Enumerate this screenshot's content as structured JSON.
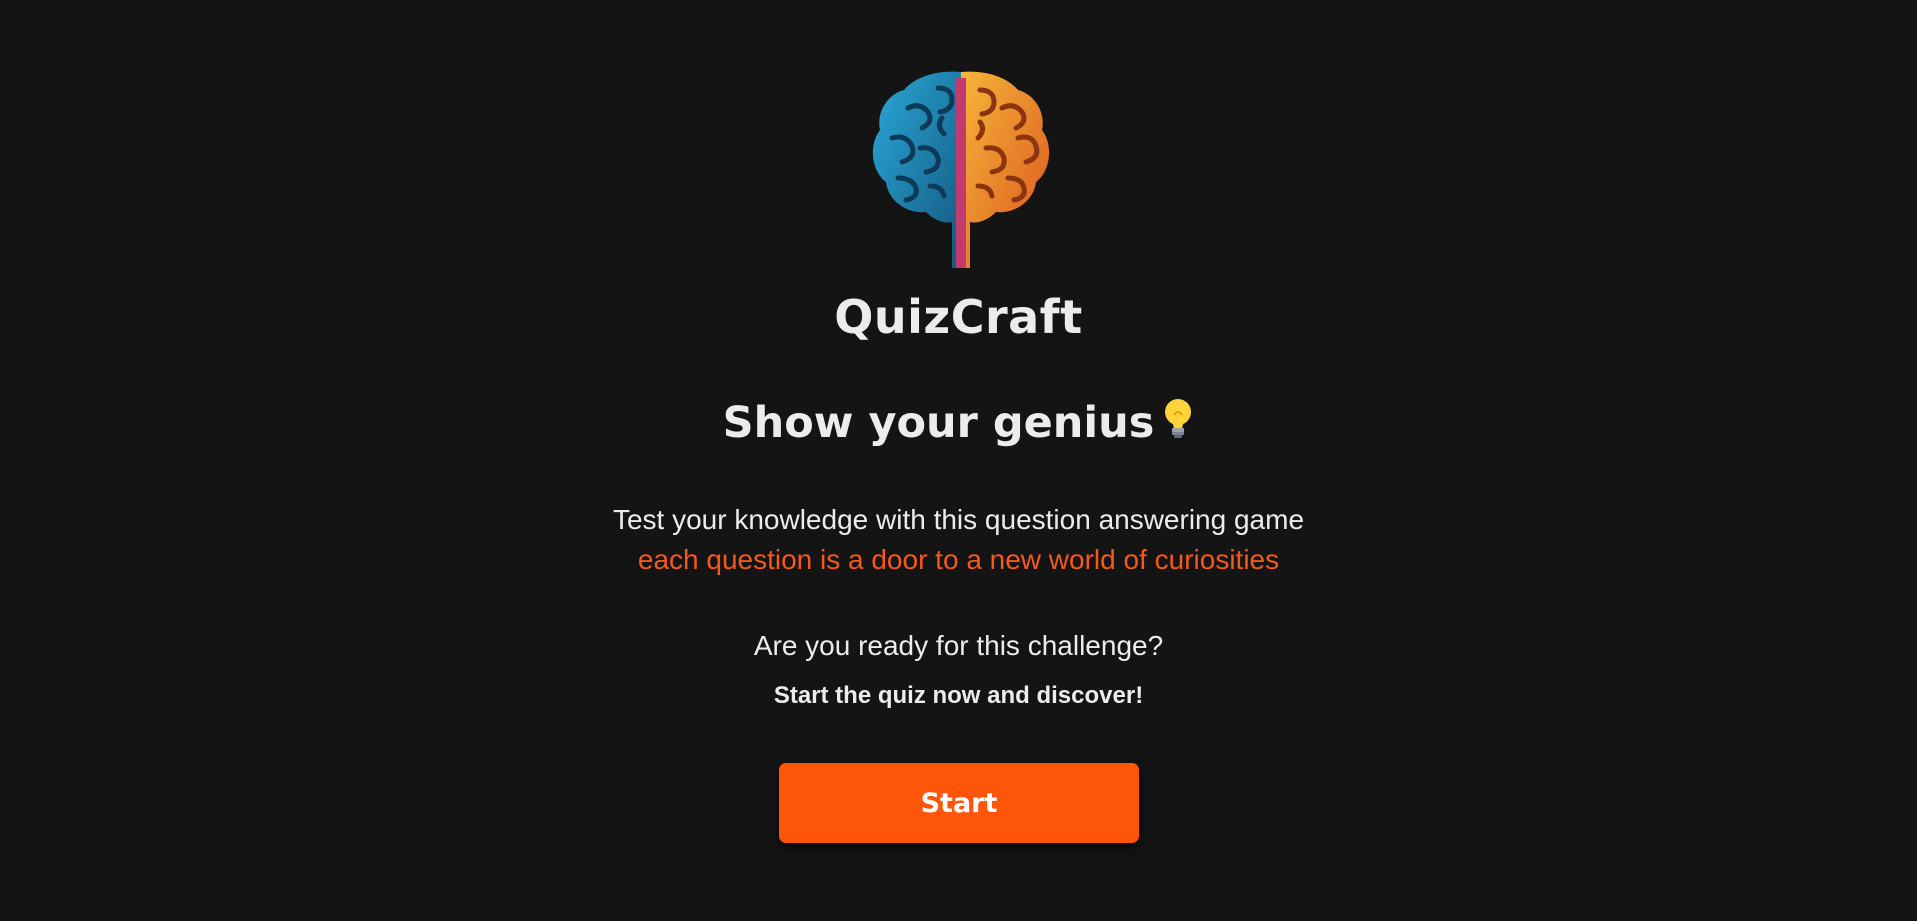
{
  "app": {
    "title": "QuizCraft",
    "logo_icon": "brain-question-logo"
  },
  "hero": {
    "headline": "Show your genius",
    "headline_icon": "lightbulb-icon",
    "description": "Test your knowledge with this question answering game",
    "highlight": "each question is a door to a new world of curiosities",
    "question": "Are you ready for this challenge?",
    "cta_text": "Start the quiz now and discover!"
  },
  "actions": {
    "start_label": "Start"
  },
  "colors": {
    "background": "#141414",
    "text": "#ececec",
    "accent": "#f4581a",
    "button": "#fd5509"
  }
}
